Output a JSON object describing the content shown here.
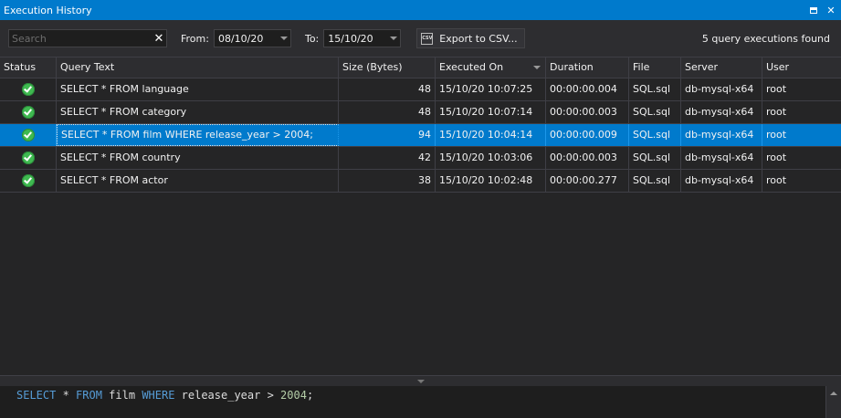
{
  "window": {
    "title": "Execution History",
    "pin_icon": "pin-icon",
    "close_icon": "close-icon"
  },
  "toolbar": {
    "search_placeholder": "Search",
    "search_value": "",
    "from_label": "From:",
    "from_value": "08/10/20",
    "to_label": "To:",
    "to_value": "15/10/20",
    "export_label": "Export to CSV...",
    "export_icon_text": "CSV",
    "found_text": "5 query executions found"
  },
  "table": {
    "sorted_column": "Executed On",
    "columns": [
      "Status",
      "Query Text",
      "Size (Bytes)",
      "Executed On",
      "Duration",
      "File",
      "Server",
      "User"
    ],
    "rows": [
      {
        "status": "success",
        "query": "SELECT * FROM language",
        "size": "48",
        "executed": "15/10/20 10:07:25",
        "duration": "00:00:00.004",
        "file": "SQL.sql",
        "server": "db-mysql-x64",
        "user": "root"
      },
      {
        "status": "success",
        "query": "SELECT * FROM category",
        "size": "48",
        "executed": "15/10/20 10:07:14",
        "duration": "00:00:00.003",
        "file": "SQL.sql",
        "server": "db-mysql-x64",
        "user": "root"
      },
      {
        "status": "success",
        "query": "SELECT * FROM film WHERE release_year > 2004;",
        "size": "94",
        "executed": "15/10/20 10:04:14",
        "duration": "00:00:00.009",
        "file": "SQL.sql",
        "server": "db-mysql-x64",
        "user": "root",
        "selected": true
      },
      {
        "status": "success",
        "query": "SELECT * FROM country",
        "size": "42",
        "executed": "15/10/20 10:03:06",
        "duration": "00:00:00.003",
        "file": "SQL.sql",
        "server": "db-mysql-x64",
        "user": "root"
      },
      {
        "status": "success",
        "query": "SELECT * FROM actor",
        "size": "38",
        "executed": "15/10/20 10:02:48",
        "duration": "00:00:00.277",
        "file": "SQL.sql",
        "server": "db-mysql-x64",
        "user": "root"
      }
    ]
  },
  "preview": {
    "tokens": [
      {
        "t": "SELECT",
        "k": "kw"
      },
      {
        "t": " * ",
        "k": "id"
      },
      {
        "t": "FROM",
        "k": "kw"
      },
      {
        "t": " film ",
        "k": "id"
      },
      {
        "t": "WHERE",
        "k": "kw"
      },
      {
        "t": " release_year > ",
        "k": "id"
      },
      {
        "t": "2004",
        "k": "nm"
      },
      {
        "t": ";",
        "k": "id"
      }
    ]
  },
  "colors": {
    "accent": "#007acc",
    "background": "#252526",
    "success": "#3fb950",
    "keyword": "#569cd6",
    "number": "#b5cea8"
  }
}
